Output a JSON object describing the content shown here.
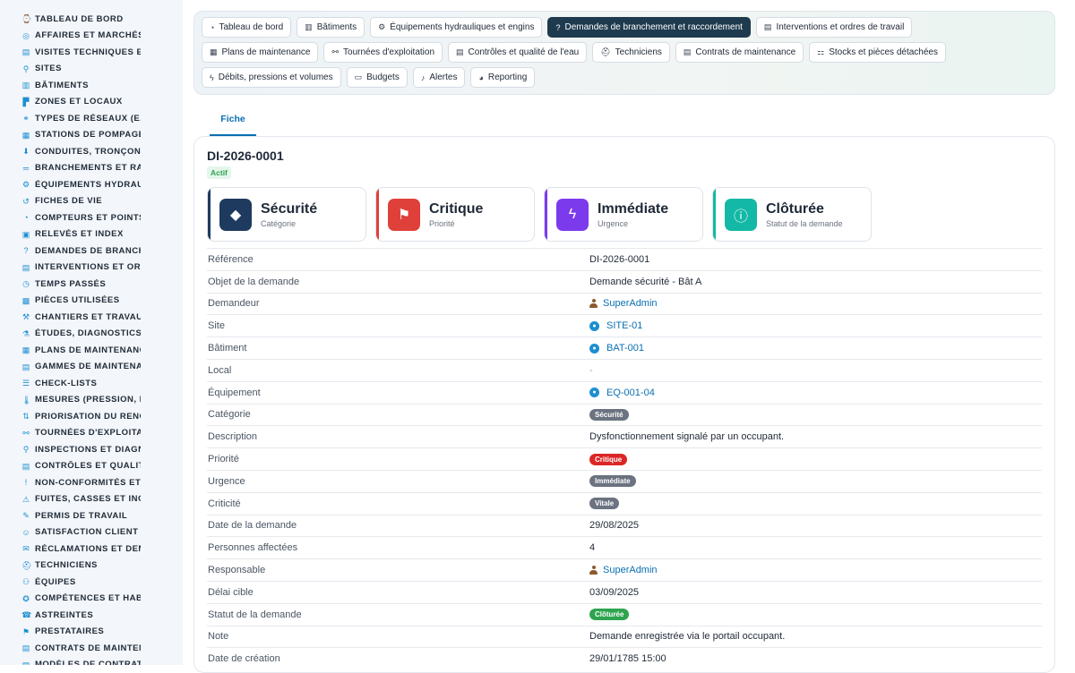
{
  "sidebar": {
    "items": [
      {
        "label": "TABLEAU DE BORD",
        "icon": "⌚"
      },
      {
        "label": "AFFAIRES ET MARCHÉS",
        "icon": "◎"
      },
      {
        "label": "VISITES TECHNIQUES ET",
        "icon": "▤"
      },
      {
        "label": "SITES",
        "icon": "⚲"
      },
      {
        "label": "BÂTIMENTS",
        "icon": "▥"
      },
      {
        "label": "ZONES ET LOCAUX",
        "icon": "▛"
      },
      {
        "label": "TYPES DE RÉSEAUX (EAU",
        "icon": "⚭"
      },
      {
        "label": "STATIONS DE POMPAGE I",
        "icon": "▦"
      },
      {
        "label": "CONDUITES, TRONÇONS",
        "icon": "⬇"
      },
      {
        "label": "BRANCHEMENTS ET RAC",
        "icon": "═"
      },
      {
        "label": "ÉQUIPEMENTS HYDRAUL",
        "icon": "⚙"
      },
      {
        "label": "FICHES DE VIE",
        "icon": "↺"
      },
      {
        "label": "COMPTEURS ET POINTS I",
        "icon": "◔"
      },
      {
        "label": "RELEVÉS ET INDEX",
        "icon": "▣"
      },
      {
        "label": "DEMANDES DE BRANCHE",
        "icon": "?"
      },
      {
        "label": "INTERVENTIONS ET ORDI",
        "icon": "▤"
      },
      {
        "label": "TEMPS PASSÉS",
        "icon": "◷"
      },
      {
        "label": "PIÈCES UTILISÉES",
        "icon": "▩"
      },
      {
        "label": "CHANTIERS ET TRAVAUX",
        "icon": "⚒"
      },
      {
        "label": "ÉTUDES, DIAGNOSTICS E",
        "icon": "⚗"
      },
      {
        "label": "PLANS DE MAINTENANCE",
        "icon": "▦"
      },
      {
        "label": "GAMMES DE MAINTENAN",
        "icon": "▤"
      },
      {
        "label": "CHECK-LISTS",
        "icon": "☰"
      },
      {
        "label": "MESURES (PRESSION, DÉ",
        "icon": "🌡"
      },
      {
        "label": "PRIORISATION DU RENOU",
        "icon": "⇅"
      },
      {
        "label": "TOURNÉES D'EXPLOITATI",
        "icon": "⚯"
      },
      {
        "label": "INSPECTIONS ET DIAGNC",
        "icon": "⚲"
      },
      {
        "label": "CONTRÔLES ET QUALITÉ",
        "icon": "▤"
      },
      {
        "label": "NON-CONFORMITÉS ET A",
        "icon": "!"
      },
      {
        "label": "FUITES, CASSES ET INCII",
        "icon": "⚠"
      },
      {
        "label": "PERMIS DE TRAVAIL",
        "icon": "✎"
      },
      {
        "label": "SATISFACTION CLIENT",
        "icon": "☺"
      },
      {
        "label": "RÉCLAMATIONS ET DEMA",
        "icon": "✉"
      },
      {
        "label": "TECHNICIENS",
        "icon": "⛑"
      },
      {
        "label": "ÉQUIPES",
        "icon": "⚇"
      },
      {
        "label": "COMPÉTENCES ET HABIL",
        "icon": "✪"
      },
      {
        "label": "ASTREINTES",
        "icon": "☎"
      },
      {
        "label": "PRESTATAIRES",
        "icon": "⚑"
      },
      {
        "label": "CONTRATS DE MAINTENA",
        "icon": "▤"
      },
      {
        "label": "MODÈLES DE CONTRATS",
        "icon": "▤"
      }
    ]
  },
  "nav": {
    "rows": [
      [
        {
          "label": "Tableau de bord",
          "icon": "◔",
          "active": false
        },
        {
          "label": "Bâtiments",
          "icon": "▥",
          "active": false
        },
        {
          "label": "Équipements hydrauliques et engins",
          "icon": "⚙",
          "active": false
        },
        {
          "label": "Demandes de branchement et raccordement",
          "icon": "?",
          "active": true
        },
        {
          "label": "Interventions et ordres de travail",
          "icon": "▤",
          "active": false
        }
      ],
      [
        {
          "label": "Plans de maintenance",
          "icon": "▦",
          "active": false
        },
        {
          "label": "Tournées d'exploitation",
          "icon": "⚯",
          "active": false
        },
        {
          "label": "Contrôles et qualité de l'eau",
          "icon": "▤",
          "active": false
        },
        {
          "label": "Techniciens",
          "icon": "⛑",
          "active": false
        },
        {
          "label": "Contrats de maintenance",
          "icon": "▤",
          "active": false
        },
        {
          "label": "Stocks et pièces détachées",
          "icon": "⚏",
          "active": false
        }
      ],
      [
        {
          "label": "Débits, pressions et volumes",
          "icon": "ϟ",
          "active": false
        },
        {
          "label": "Budgets",
          "icon": "▭",
          "active": false
        },
        {
          "label": "Alertes",
          "icon": "♪",
          "active": false
        },
        {
          "label": "Reporting",
          "icon": "◕",
          "active": false
        }
      ]
    ]
  },
  "tabs": {
    "fiche": "Fiche"
  },
  "record": {
    "title": "DI-2026-0001",
    "status": "Actif"
  },
  "kpis": [
    {
      "value": "Sécurité",
      "label": "Catégorie",
      "color": "#1e3a5f",
      "icon": "tag-icon"
    },
    {
      "value": "Critique",
      "label": "Priorité",
      "color": "#e0403a",
      "icon": "flag-icon"
    },
    {
      "value": "Immédiate",
      "label": "Urgence",
      "color": "#7c3aed",
      "icon": "bolt-icon"
    },
    {
      "value": "Clôturée",
      "label": "Statut de la demande",
      "color": "#14b8a6",
      "icon": "info-icon"
    }
  ],
  "details": [
    {
      "key": "Référence",
      "value": "DI-2026-0001",
      "type": "text"
    },
    {
      "key": "Objet de la demande",
      "value": "Demande sécurité - Bât A",
      "type": "text"
    },
    {
      "key": "Demandeur",
      "value": "SuperAdmin",
      "type": "user"
    },
    {
      "key": "Site",
      "value": "SITE-01",
      "type": "ref"
    },
    {
      "key": "Bâtiment",
      "value": "BAT-001",
      "type": "ref"
    },
    {
      "key": "Local",
      "value": "-",
      "type": "empty"
    },
    {
      "key": "Équipement",
      "value": "EQ-001-04",
      "type": "ref"
    },
    {
      "key": "Catégorie",
      "value": "Sécurité",
      "type": "badge",
      "color": "#6b7280"
    },
    {
      "key": "Description",
      "value": "Dysfonctionnement signalé par un occupant.",
      "type": "text"
    },
    {
      "key": "Priorité",
      "value": "Critique",
      "type": "badge",
      "color": "#dc2626"
    },
    {
      "key": "Urgence",
      "value": "Immédiate",
      "type": "badge",
      "color": "#6b7280"
    },
    {
      "key": "Criticité",
      "value": "Vitale",
      "type": "badge",
      "color": "#6b7280"
    },
    {
      "key": "Date de la demande",
      "value": "29/08/2025",
      "type": "text"
    },
    {
      "key": "Personnes affectées",
      "value": "4",
      "type": "text"
    },
    {
      "key": "Responsable",
      "value": "SuperAdmin",
      "type": "user"
    },
    {
      "key": "Délai cible",
      "value": "03/09/2025",
      "type": "text"
    },
    {
      "key": "Statut de la demande",
      "value": "Clôturée",
      "type": "badge",
      "color": "#2ea44f"
    },
    {
      "key": "Note",
      "value": "Demande enregistrée via le portail occupant.",
      "type": "text"
    },
    {
      "key": "Date de création",
      "value": "29/01/1785 15:00",
      "type": "text"
    }
  ]
}
